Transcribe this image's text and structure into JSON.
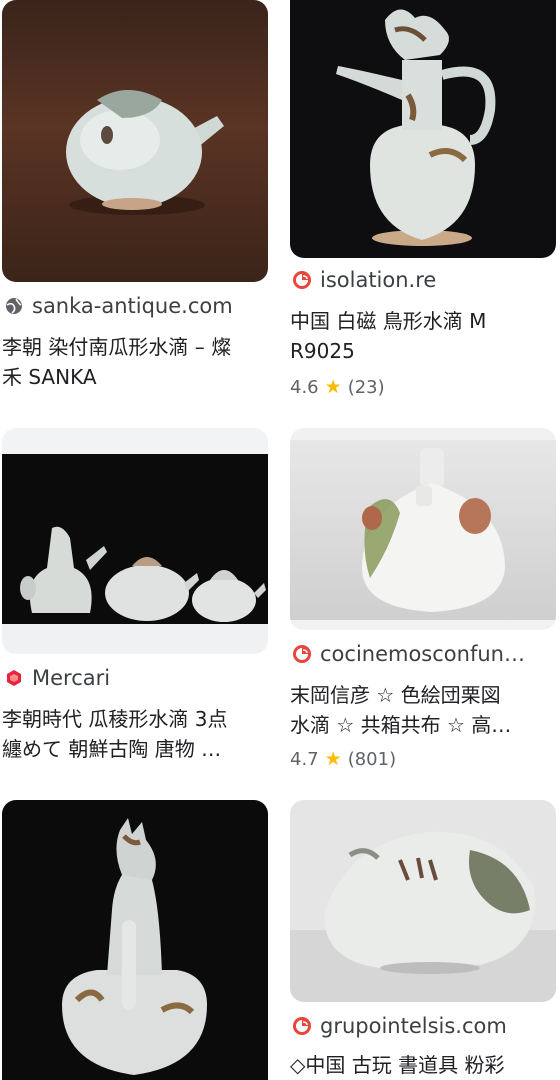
{
  "results": [
    {
      "source": "sanka-antique.com",
      "favicon": "globe-icon",
      "title_line1": "李朝 染付南瓜形水滴 – 燦",
      "title_line2": "禾 SANKA"
    },
    {
      "source": "isolation.re",
      "favicon": "site-logo-icon",
      "title_line1": "中国 白磁 鳥形水滴 M",
      "title_line2": "R9025",
      "rating": "4.6",
      "reviews": "(23)"
    },
    {
      "source": "Mercari",
      "favicon": "mercari-logo-icon",
      "title_line1": "李朝時代 瓜稜形水滴 3点",
      "title_line2": "纏めて 朝鮮古陶 唐物 …"
    },
    {
      "source": "cocinemosconfun…",
      "favicon": "site-logo-icon",
      "title_line1": "末岡信彦 ☆ 色絵団栗図",
      "title_line2": "水滴 ☆ 共箱共布 ☆ 高…",
      "rating": "4.7",
      "reviews": "(801)"
    },
    {
      "source": "grupointelsis.com",
      "favicon": "site-logo-icon",
      "title_line1": "◇中国 古玩 書道具 粉彩"
    }
  ],
  "colors": {
    "star": "#fbbc04",
    "logo_red": "#e8453c",
    "mercari_red": "#e4253b"
  }
}
